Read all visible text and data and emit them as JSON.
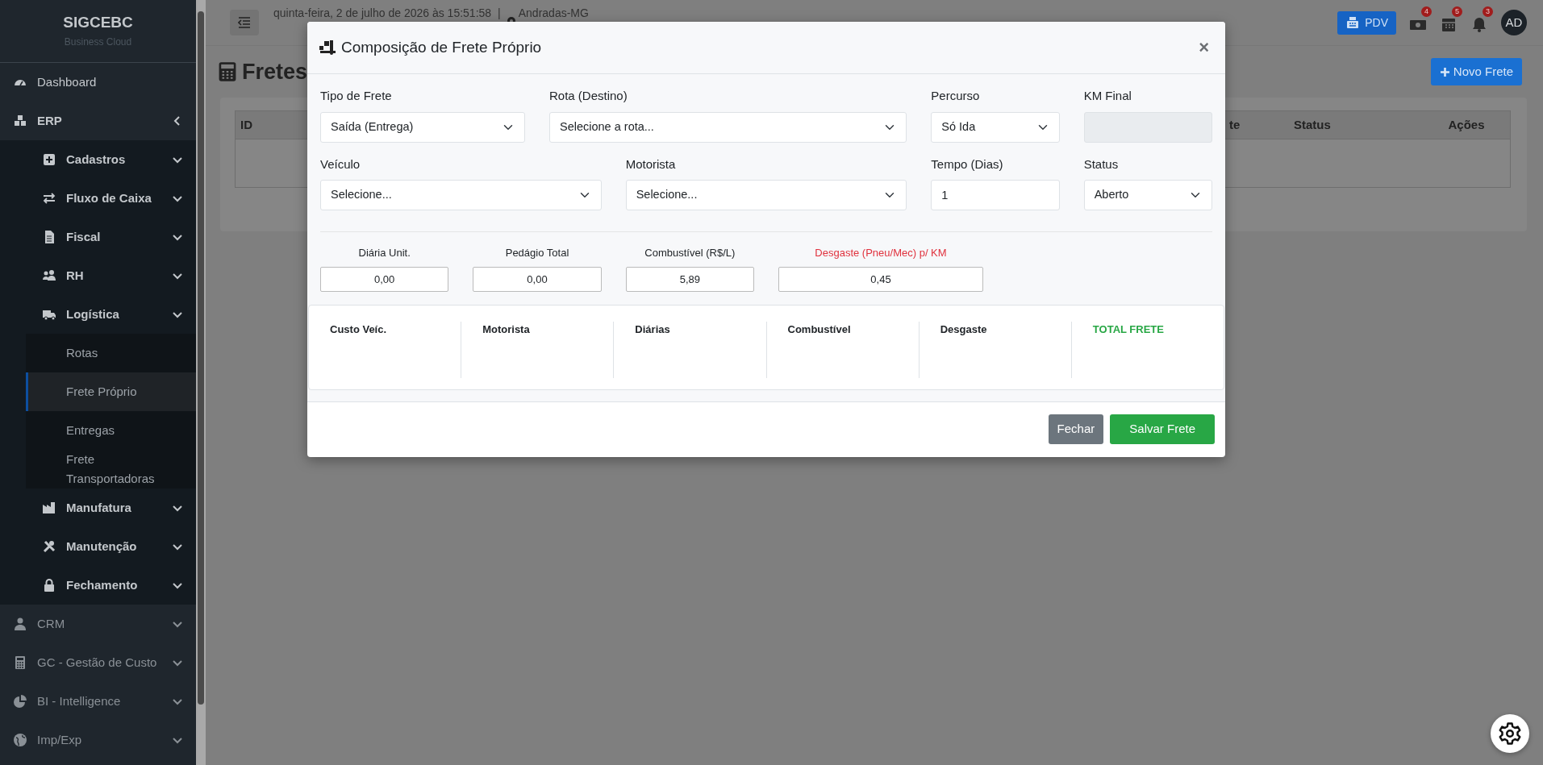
{
  "sidebar": {
    "brand": "SIGCEBC",
    "subtitle": "Business Cloud",
    "items": [
      {
        "label": "Dashboard",
        "selected": false
      },
      {
        "label": "ERP",
        "selected": false,
        "expanded": true,
        "children": [
          {
            "label": "Cadastros",
            "selected": false,
            "expanded": false
          },
          {
            "label": "Fluxo de Caixa",
            "selected": false,
            "expanded": false
          },
          {
            "label": "Fiscal",
            "selected": false,
            "expanded": false
          },
          {
            "label": "RH",
            "selected": false,
            "expanded": false
          },
          {
            "label": "Logística",
            "selected": false,
            "expanded": true,
            "children": [
              {
                "label": "Rotas",
                "selected": false
              },
              {
                "label": "Frete Próprio",
                "selected": true
              },
              {
                "label": "Entregas",
                "selected": false
              },
              {
                "label": "Frete Transportadoras",
                "selected": false
              }
            ]
          },
          {
            "label": "Manufatura",
            "selected": false,
            "expanded": false
          },
          {
            "label": "Manutenção",
            "selected": false,
            "expanded": false
          },
          {
            "label": "Fechamento",
            "selected": false,
            "expanded": false
          }
        ]
      },
      {
        "label": "CRM",
        "selected": false,
        "expanded": false
      },
      {
        "label": "GC - Gestão de Custo",
        "selected": false,
        "expanded": false
      },
      {
        "label": "BI - Intelligence",
        "selected": false,
        "expanded": false
      },
      {
        "label": "Imp/Exp",
        "selected": false,
        "expanded": false
      }
    ]
  },
  "topbar": {
    "datetime": "quinta-feira, 2 de julho de 2026 às 15:51:58",
    "separator": "|",
    "location": "Andradas-MG",
    "pdv_button": "PDV",
    "notifications": [
      {
        "count": "4"
      },
      {
        "count": "5"
      },
      {
        "count": "3"
      }
    ],
    "avatar": "AD"
  },
  "page": {
    "title": "Fretes",
    "new_button": "Novo Frete",
    "table": {
      "columns": [
        "ID",
        "te",
        "Status",
        "Ações"
      ]
    }
  },
  "modal": {
    "title": "Composição de Frete Próprio",
    "close": "×",
    "fields": [
      {
        "label": "Tipo de Frete",
        "kind": "select",
        "value": "Saída (Entrega)",
        "disabled": false
      },
      {
        "label": "Rota (Destino)",
        "kind": "select",
        "value": "Selecione a rota...",
        "disabled": false
      },
      {
        "label": "Percurso",
        "kind": "select",
        "value": "Só Ida",
        "disabled": false
      },
      {
        "label": "KM Final",
        "kind": "input",
        "disabled": true
      },
      {
        "label": "Veículo",
        "kind": "select",
        "value": "Selecione...",
        "disabled": false
      },
      {
        "label": "Motorista",
        "kind": "select",
        "value": "Selecione...",
        "disabled": false
      },
      {
        "label": "Tempo (Dias)",
        "kind": "input",
        "value": "1",
        "disabled": false
      },
      {
        "label": "Status",
        "kind": "select",
        "value": "Aberto",
        "disabled": false
      }
    ],
    "costs": [
      {
        "label": "Diária Unit.",
        "value": "0,00",
        "warning": false
      },
      {
        "label": "Pedágio Total",
        "value": "0,00",
        "warning": false
      },
      {
        "label": "Combustível (R$/L)",
        "value": "5,89",
        "warning": false
      },
      {
        "label": "Desgaste (Pneu/Mec) p/ KM",
        "value": "0,45",
        "warning": true
      }
    ],
    "summary": [
      {
        "label": "Custo Veíc.",
        "kind": "item"
      },
      {
        "label": "Motorista",
        "kind": "item"
      },
      {
        "label": "Diárias",
        "kind": "item"
      },
      {
        "label": "Combustível",
        "kind": "item"
      },
      {
        "label": "Desgaste",
        "kind": "item"
      },
      {
        "label": "TOTAL FRETE",
        "kind": "total"
      }
    ],
    "buttons": [
      {
        "label": "Fechar",
        "kind": "secondary"
      },
      {
        "label": "Salvar Frete",
        "kind": "primary"
      }
    ]
  }
}
